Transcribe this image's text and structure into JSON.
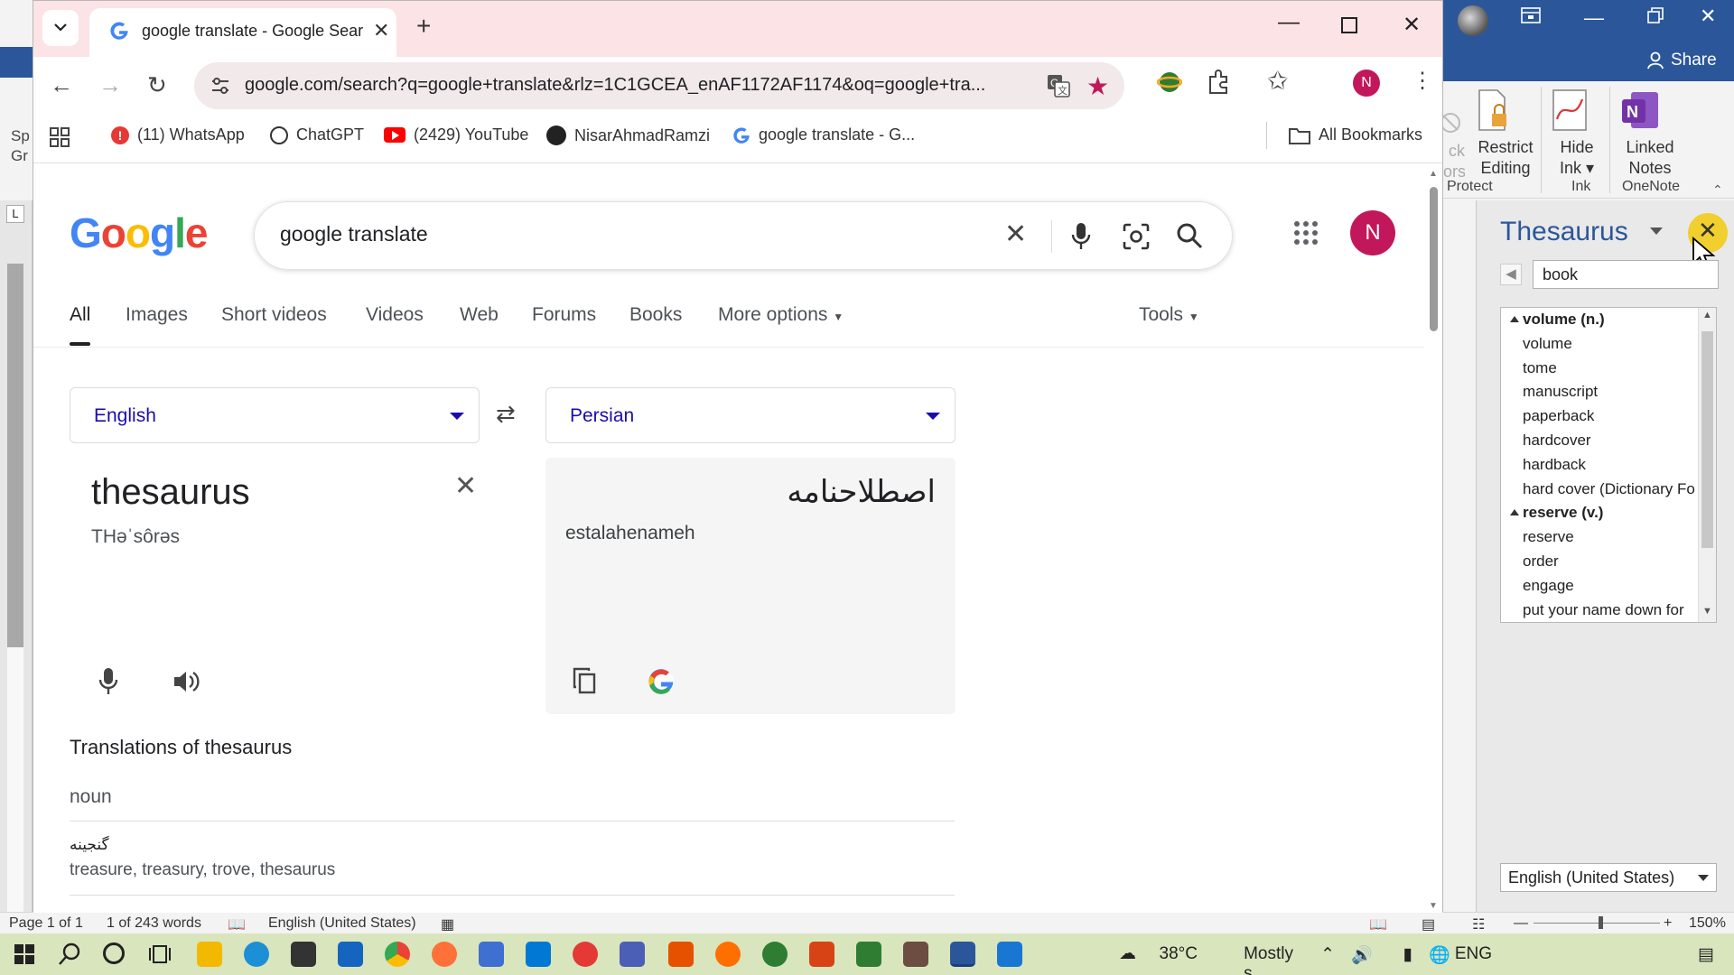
{
  "word": {
    "left_ribbon_text": [
      "Sp",
      "Gr"
    ],
    "share_label": "Share",
    "ribbon": {
      "protect_a_line1": "ck",
      "protect_a_line2": "ors",
      "restrict_line1": "Restrict",
      "restrict_line2": "Editing",
      "hide_ink_line1": "Hide",
      "hide_ink_line2": "Ink",
      "linked_line1": "Linked",
      "linked_line2": "Notes",
      "group_protect": "Protect",
      "group_ink": "Ink",
      "group_onenote": "OneNote"
    },
    "ruler_marker": "L",
    "status": {
      "page": "Page 1 of 1",
      "words": "1 of 243 words",
      "language": "English (United States)",
      "zoom": "150%"
    }
  },
  "thesaurus": {
    "title": "Thesaurus",
    "search_value": "book",
    "list": [
      {
        "type": "header",
        "text": "volume (n.)"
      },
      {
        "type": "item",
        "text": "volume"
      },
      {
        "type": "item",
        "text": "tome"
      },
      {
        "type": "item",
        "text": "manuscript"
      },
      {
        "type": "item",
        "text": "paperback"
      },
      {
        "type": "item",
        "text": "hardcover"
      },
      {
        "type": "item",
        "text": "hardback"
      },
      {
        "type": "item",
        "text": "hard cover (Dictionary Fo"
      },
      {
        "type": "header",
        "text": "reserve (v.)"
      },
      {
        "type": "item",
        "text": "reserve"
      },
      {
        "type": "item",
        "text": "order"
      },
      {
        "type": "item",
        "text": "engage"
      },
      {
        "type": "item",
        "text": "put your name down for"
      }
    ],
    "language": "English (United States)"
  },
  "chrome": {
    "tab_title": "google translate - Google Searc",
    "url": "google.com/search?q=google+translate&rlz=1C1GCEA_enAF1172AF1174&oq=google+tra...",
    "profile_initial": "N",
    "bookmarks": [
      {
        "label": "(11) WhatsApp",
        "icon": "whatsapp-icon"
      },
      {
        "label": "ChatGPT",
        "icon": "chatgpt-icon"
      },
      {
        "label": "(2429) YouTube",
        "icon": "youtube-icon"
      },
      {
        "label": "NisarAhmadRamzi",
        "icon": "github-icon"
      },
      {
        "label": "google translate - G...",
        "icon": "google-icon"
      }
    ],
    "all_bookmarks": "All Bookmarks"
  },
  "google": {
    "logo": "Google",
    "query": "google translate",
    "avatar_initial": "N",
    "tabs": [
      "All",
      "Images",
      "Short videos",
      "Videos",
      "Web",
      "Forums",
      "Books",
      "More options"
    ],
    "tools": "Tools",
    "source_lang": "English",
    "target_lang": "Persian",
    "source_text": "thesaurus",
    "source_phonetic": "THəˈsôrəs",
    "target_text": "اصطلاحنامه",
    "target_translit": "estalahenameh",
    "translations_title": "Translations of thesaurus",
    "part_of_speech": "noun",
    "persian_word": "گنجینه",
    "english_words": "treasure, treasury, trove, thesaurus"
  },
  "taskbar": {
    "temperature": "38°C",
    "weather": "Mostly s...",
    "lang": "ENG"
  }
}
